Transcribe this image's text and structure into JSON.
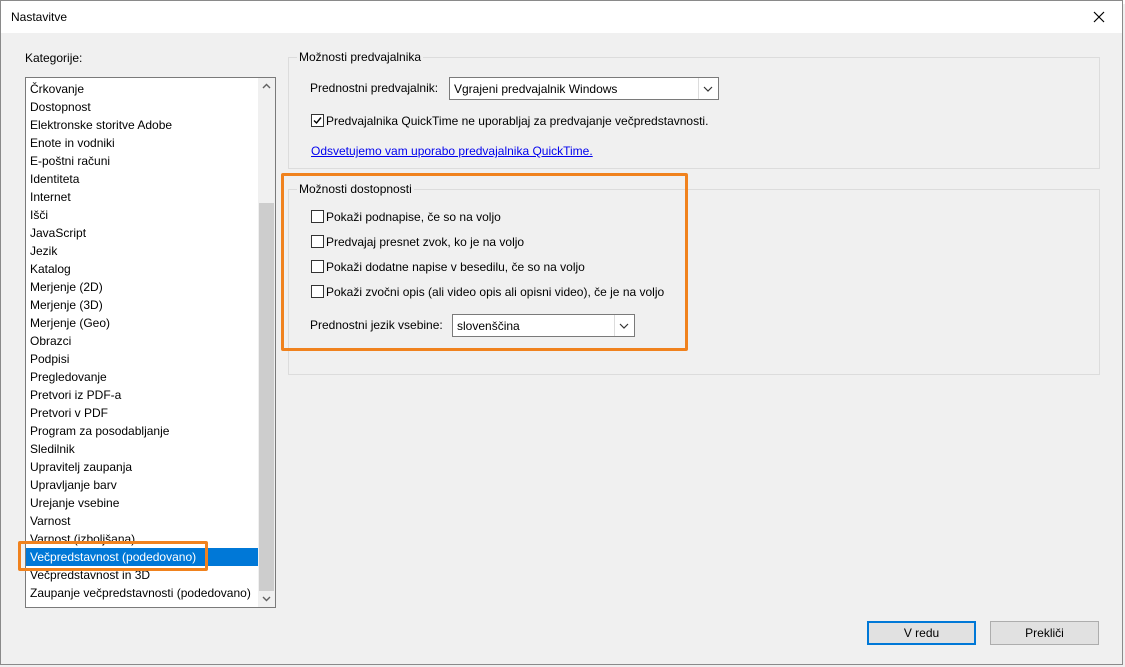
{
  "window": {
    "title": "Nastavitve"
  },
  "categories": {
    "label": "Kategorije:",
    "items": [
      "Črkovanje",
      "Dostopnost",
      "Elektronske storitve Adobe",
      "Enote in vodniki",
      "E-poštni računi",
      "Identiteta",
      "Internet",
      "Išči",
      "JavaScript",
      "Jezik",
      "Katalog",
      "Merjenje (2D)",
      "Merjenje (3D)",
      "Merjenje (Geo)",
      "Obrazci",
      "Podpisi",
      "Pregledovanje",
      "Pretvori iz PDF-a",
      "Pretvori v PDF",
      "Program za posodabljanje",
      "Sledilnik",
      "Upravitelj zaupanja",
      "Upravljanje barv",
      "Urejanje vsebine",
      "Varnost",
      "Varnost (izboljšana)",
      "Večpredstavnost (podedovano)",
      "Večpredstavnost in 3D",
      "Zaupanje večpredstavnosti (podedovano)"
    ],
    "selected": "Večpredstavnost (podedovano)"
  },
  "player_options": {
    "title": "Možnosti predvajalnika",
    "preferred_label": "Prednostni predvajalnik:",
    "preferred_value": "Vgrajeni predvajalnik Windows",
    "quicktime_checkbox_label": "Predvajalnika QuickTime ne uporabljaj za predvajanje večpredstavnosti.",
    "quicktime_checked": true,
    "quicktime_link": "Odsvetujemo vam uporabo predvajalnika QuickTime."
  },
  "accessibility_options": {
    "title": "Možnosti dostopnosti",
    "checkboxes": [
      {
        "label": "Pokaži podnapise, če so na voljo",
        "checked": false
      },
      {
        "label": "Predvajaj presnet zvok, ko je na voljo",
        "checked": false
      },
      {
        "label": "Pokaži dodatne napise v besedilu, če so na voljo",
        "checked": false
      },
      {
        "label": "Pokaži zvočni opis (ali video opis ali opisni video), če je na voljo",
        "checked": false
      }
    ],
    "language_label": "Prednostni jezik vsebine:",
    "language_value": "slovenščina"
  },
  "buttons": {
    "ok": "V redu",
    "cancel": "Prekliči"
  },
  "colors": {
    "highlight": "#f0821e",
    "selection": "#0078d7",
    "link": "#0000ee"
  }
}
